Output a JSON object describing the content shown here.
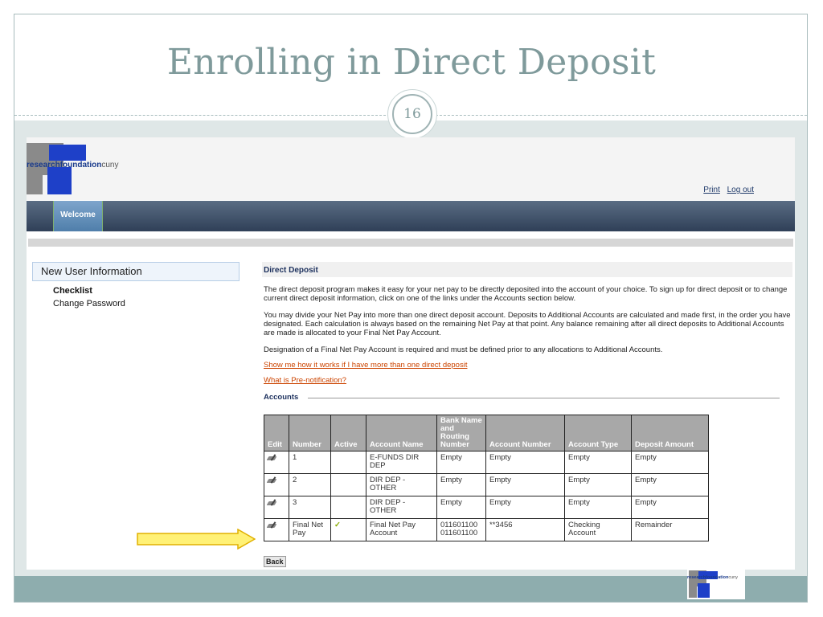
{
  "slide": {
    "title": "Enrolling in Direct Deposit",
    "page_number": "16"
  },
  "header": {
    "logo_text": "researchfoundation",
    "logo_suffix": "cuny",
    "print_label": "Print",
    "logout_label": "Log out"
  },
  "nav": {
    "welcome_tab": "Welcome"
  },
  "sidebar": {
    "heading": "New User Information",
    "items": [
      "Checklist",
      "Change Password"
    ]
  },
  "main": {
    "section_title": "Direct Deposit",
    "para1": "The direct deposit program makes it easy for your net pay to be directly deposited into the account of your choice. To sign up for direct deposit or to change current direct deposit information, click on one of the links under the Accounts section below.",
    "para2": "You may divide your Net Pay into more than one direct deposit account. Deposits to Additional Accounts are calculated and made first, in the order you have designated. Each calculation is always based on the remaining Net Pay at that point. Any balance remaining after all direct deposits to Additional Accounts are made is allocated to your Final Net Pay Account.",
    "para3": "Designation of a Final Net Pay Account is required and must be defined prior to any allocations to Additional Accounts.",
    "link1": "Show me how it works if I have more than one direct deposit",
    "link2": "What is Pre-notification?",
    "accounts_label": "Accounts",
    "back_label": "Back"
  },
  "table": {
    "headers": [
      "Edit",
      "Number",
      "Active",
      "Account Name",
      "Bank Name and Routing Number",
      "Account Number",
      "Account Type",
      "Deposit Amount"
    ],
    "rows": [
      {
        "number": "1",
        "active": "",
        "account_name": "E-FUNDS DIR DEP",
        "bank": "Empty",
        "account_number": "Empty",
        "account_type": "Empty",
        "deposit_amount": "Empty"
      },
      {
        "number": "2",
        "active": "",
        "account_name": "DIR DEP - OTHER",
        "bank": "Empty",
        "account_number": "Empty",
        "account_type": "Empty",
        "deposit_amount": "Empty"
      },
      {
        "number": "3",
        "active": "",
        "account_name": "DIR DEP - OTHER",
        "bank": "Empty",
        "account_number": "Empty",
        "account_type": "Empty",
        "deposit_amount": "Empty"
      },
      {
        "number": "Final Net Pay",
        "active": "✓",
        "account_name": "Final Net Pay Account",
        "bank": "011601100 011601100",
        "account_number": "**3456",
        "account_type": "Checking Account",
        "deposit_amount": "Remainder"
      }
    ]
  },
  "colors": {
    "title": "#7f9a9b",
    "nav_dark": "#2f3f57",
    "arrow_fill": "#fff176",
    "arrow_stroke": "#e0b000",
    "link": "#cc4400"
  }
}
